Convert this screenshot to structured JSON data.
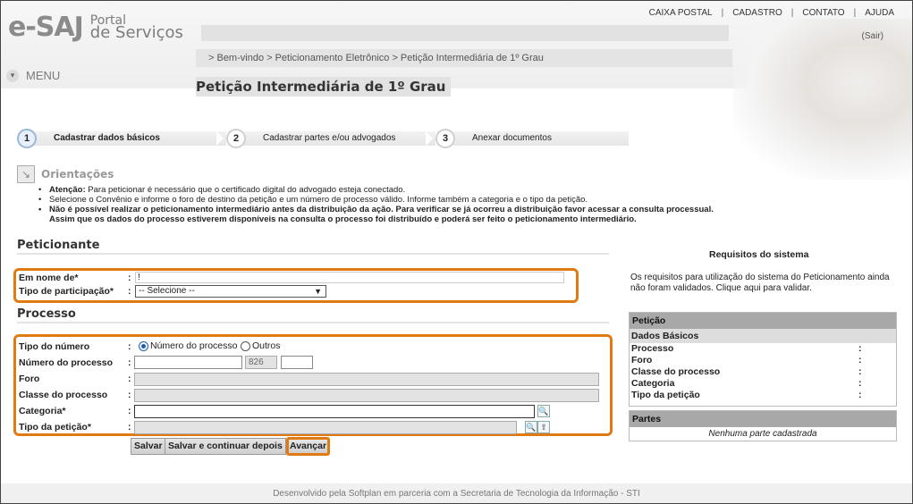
{
  "header": {
    "logo_main": "e-SAJ",
    "logo_line1": "Portal",
    "logo_line2": "de Serviços",
    "nav": [
      "CAIXA POSTAL",
      "CADASTRO",
      "CONTATO",
      "AJUDA"
    ],
    "nav_sep": "|",
    "logout": "(Sair)",
    "breadcrumb": "> Bem-vindo > Peticionamento Eletrônico > Petição Intermediária de 1º Grau",
    "menu_label": "MENU"
  },
  "page_title": "Petição Intermediária de 1º Grau",
  "stepper": [
    {
      "num": "1",
      "label": "Cadastrar dados básicos",
      "active": true
    },
    {
      "num": "2",
      "label": "Cadastrar partes e/ou advogados",
      "active": false
    },
    {
      "num": "3",
      "label": "Anexar documentos",
      "active": false
    }
  ],
  "orientacoes": {
    "title": "Orientações",
    "item1_bold": "Atenção:",
    "item1_text": " Para peticionar é necessário que o certificado digital do advogado esteja conectado.",
    "item2": "Selecione o Convênio e informe o foro de destino da petição e um número de processo válido. Informe também a categoria e o tipo da petição.",
    "item3": "Não é possível realizar o peticionamento intermediário antes da distribuição da ação. Para verificar se já ocorreu a distribuição favor acessar a consulta processual.",
    "item4": "Assim que os dados do processo estiverem disponíveis na consulta o processo foi distribuído e poderá ser feito o peticionamento intermediário."
  },
  "peticionante": {
    "title": "Peticionante",
    "em_nome_de_label": "Em nome de*",
    "em_nome_de_value": "!",
    "tipo_participacao_label": "Tipo de participação*",
    "tipo_participacao_value": "-- Selecione --"
  },
  "processo": {
    "title": "Processo",
    "tipo_numero_label": "Tipo do número",
    "opt_numero": "Número do processo",
    "opt_outros": "Outros",
    "numero_label": "Número do processo",
    "numero_segment2": "826",
    "foro_label": "Foro",
    "classe_label": "Classe do processo",
    "categoria_label": "Categoria*",
    "tipo_peticao_label": "Tipo da petição*",
    "colon": ":"
  },
  "buttons": {
    "salvar": "Salvar",
    "salvar_continuar": "Salvar e continuar depois",
    "avancar": "Avançar"
  },
  "requisitos": {
    "title": "Requisitos do sistema",
    "text": "Os requisitos para utilização do sistema do Peticionamento ainda não foram validados. Clique aqui para validar."
  },
  "summary": {
    "peticao_head": "Petição",
    "dados_basicos": "Dados Básicos",
    "rows": [
      "Processo",
      "Foro",
      "Classe do processo",
      "Categoria",
      "Tipo da petição"
    ],
    "partes_head": "Partes",
    "partes_empty": "Nenhuma parte cadastrada"
  },
  "footer": "Desenvolvido pela Softplan em parceria com a Secretaria de Tecnologia da Informação - STI",
  "colors": {
    "highlight": "#e07b14",
    "accent_blue": "#1a5fb4"
  }
}
